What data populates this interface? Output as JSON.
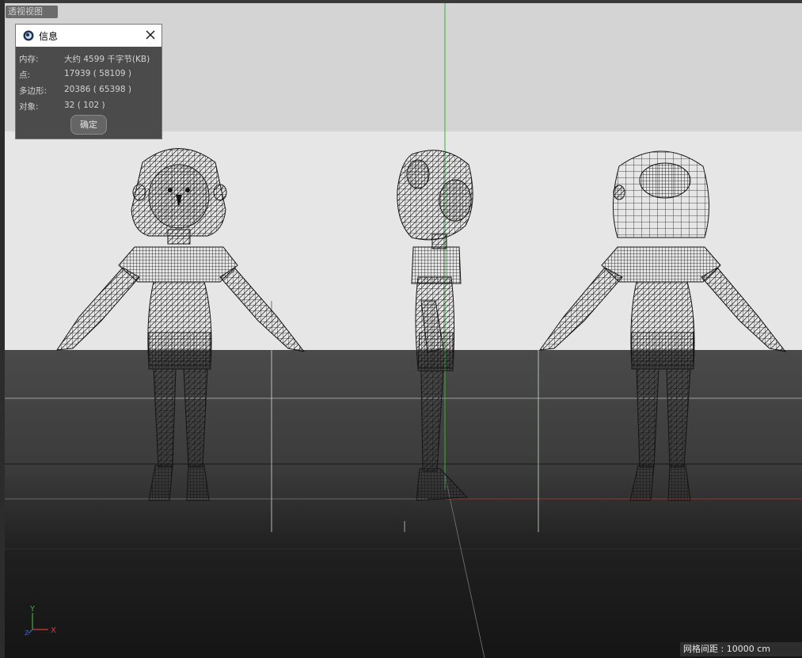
{
  "viewport": {
    "camera_label": "透视视图",
    "grid_spacing": "网格间距 : 10000 cm"
  },
  "info_dialog": {
    "title": "信息",
    "rows": [
      {
        "label": "内存:",
        "value": "大约 4599 千字节(KB)"
      },
      {
        "label": "点:",
        "value": "17939 ( 58109 )"
      },
      {
        "label": "多边形:",
        "value": "20386 ( 65398 )"
      },
      {
        "label": "对象:",
        "value": "32 ( 102 )"
      }
    ],
    "ok_label": "确定"
  },
  "axis_gizmo": {
    "y": "Y",
    "x": "X",
    "z": "Z"
  },
  "colors": {
    "wire": "#141414",
    "axis_green": "#3cae3c",
    "axis_red": "#d23c3c",
    "axis_blue": "#3c64d2",
    "guide": "#c8e6c8"
  },
  "icons": [
    "cinema4d-logo-icon",
    "close-icon"
  ]
}
